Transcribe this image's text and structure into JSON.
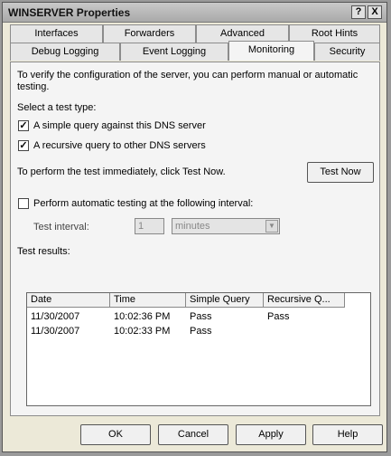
{
  "window": {
    "title": "WINSERVER Properties"
  },
  "titlebar_buttons": {
    "help": "?",
    "close": "X"
  },
  "tabs_row1": [
    "Interfaces",
    "Forwarders",
    "Advanced",
    "Root Hints"
  ],
  "tabs_row2": [
    "Debug Logging",
    "Event Logging",
    "Monitoring",
    "Security"
  ],
  "active_tab": "Monitoring",
  "intro": "To verify the configuration of the server, you can perform manual or automatic testing.",
  "select_label": "Select a test type:",
  "checks": {
    "simple": {
      "label": "A simple query against this DNS server",
      "checked": true
    },
    "recursive": {
      "label": "A recursive query to other DNS servers",
      "checked": true
    }
  },
  "test_now_text": "To perform the test immediately, click Test Now.",
  "test_now_button": "Test Now",
  "auto": {
    "label": "Perform automatic testing at the following interval:",
    "checked": false
  },
  "interval": {
    "label": "Test interval:",
    "value": "1",
    "unit": "minutes"
  },
  "results_label": "Test results:",
  "columns": [
    "Date",
    "Time",
    "Simple Query",
    "Recursive Q..."
  ],
  "rows": [
    [
      "11/30/2007",
      "10:02:36 PM",
      "Pass",
      "Pass"
    ],
    [
      "11/30/2007",
      "10:02:33 PM",
      "Pass",
      ""
    ]
  ],
  "buttons": {
    "ok": "OK",
    "cancel": "Cancel",
    "apply": "Apply",
    "help": "Help"
  }
}
